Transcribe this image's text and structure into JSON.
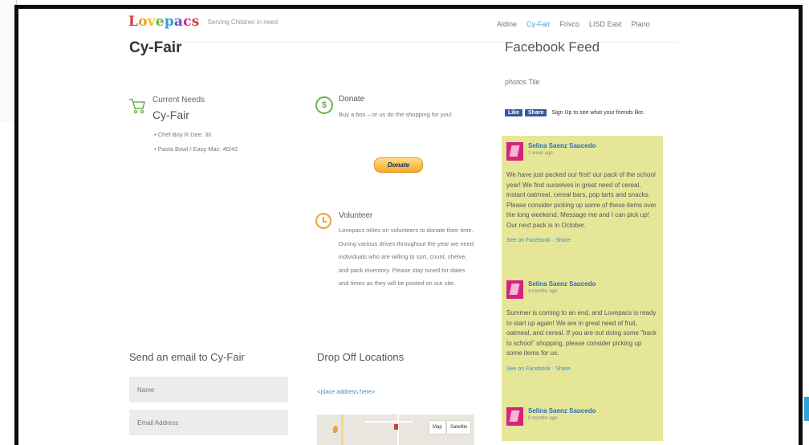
{
  "header": {
    "logo_letters": [
      {
        "ch": "L",
        "color": "#d63a3a"
      },
      {
        "ch": "o",
        "color": "#f19c1a"
      },
      {
        "ch": "v",
        "color": "#f3c21b"
      },
      {
        "ch": "e",
        "color": "#6ab04c"
      },
      {
        "ch": "p",
        "color": "#2fa3d9"
      },
      {
        "ch": "a",
        "color": "#6c4fb6"
      },
      {
        "ch": "c",
        "color": "#d6247e"
      },
      {
        "ch": "s",
        "color": "#d63a3a"
      }
    ],
    "tagline": "Serving Children in need",
    "nav": [
      "Aldine",
      "Cy-Fair",
      "Frisco",
      "LISD East",
      "Plano"
    ],
    "nav_active": "Cy-Fair"
  },
  "page": {
    "title": "Cy-Fair"
  },
  "needs": {
    "label": "Current Needs",
    "city": "Cy-Fair",
    "items": [
      "Chef Boy R Dee: 30",
      "Pasta Bowl / Easy Mac: 40/42"
    ]
  },
  "donate": {
    "title": "Donate",
    "text": "Buy a box – or us do the shopping for you!",
    "button": "Donate"
  },
  "volunteer": {
    "title": "Volunteer",
    "text": "Lovepacs relies on volunteers to donate their time. During various drives throughout the year we need individuals who are willing to sort, count, shelve, and pack inventory. Please stay tuned for dates and times as they will be posted on our site."
  },
  "email": {
    "title": "Send an email to Cy-Fair",
    "name_placeholder": "Name",
    "email_placeholder": "Email Address"
  },
  "dropoff": {
    "title": "Drop Off Locations",
    "link": "<place address here>",
    "map_buttons": [
      "Map",
      "Satellite"
    ]
  },
  "facebook": {
    "title": "Facebook Feed",
    "photos_label": "photos Tile",
    "like_btn": "Like",
    "share_btn": "Share",
    "like_text": "Sign Up to see what your friends like.",
    "posts": [
      {
        "name": "Selina Saenz Saucedo",
        "time": "1 week ago",
        "body": "We have just packed our first! our pack of the school year! We find ourselves in great need of cereal, instant oatmeal, cereal bars, pop tarts and snacks. Please consider picking up some of these items over the long weekend. Message me and I can pick up! Our next pack is in October.",
        "actions": "See on Facebook · Share"
      },
      {
        "name": "Selina Saenz Saucedo",
        "time": "4 months ago",
        "body": "Summer is coming to an end, and Lovepacs is ready to start up again! We are in great need of fruit, oatmeal, and cereal. If you are out doing some \"back to school\" shopping, please consider picking up some items for us.",
        "actions": "See on Facebook · Share"
      },
      {
        "name": "Selina Saenz Saucedo",
        "time": "6 months ago",
        "body": "",
        "actions": ""
      }
    ]
  },
  "colors": {
    "accent": "#3aa6d8",
    "feed_bg": "#e6e699",
    "frame": "#0b0b0b"
  }
}
